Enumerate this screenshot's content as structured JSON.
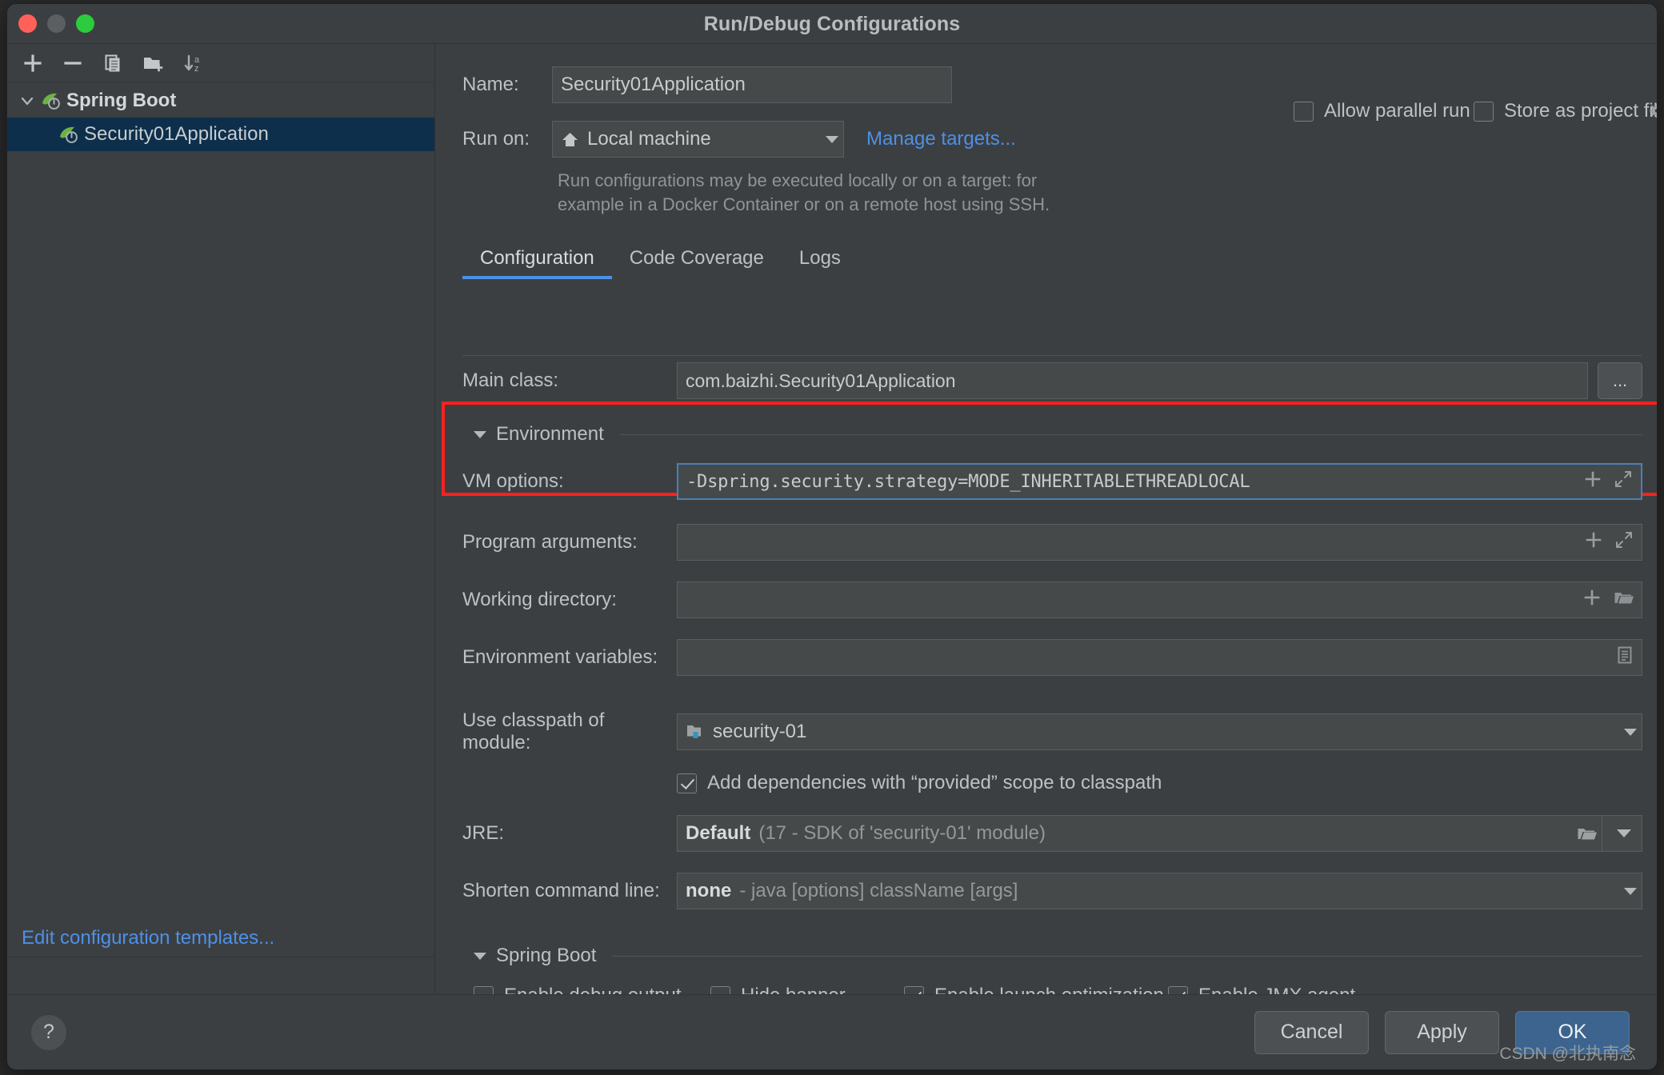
{
  "window": {
    "title": "Run/Debug Configurations",
    "traffic_lights": [
      "close",
      "minimize",
      "zoom"
    ]
  },
  "left_panel": {
    "toolbar": [
      {
        "name": "add-configuration-button",
        "icon": "plus-icon"
      },
      {
        "name": "remove-configuration-button",
        "icon": "minus-icon"
      },
      {
        "name": "copy-configuration-button",
        "icon": "copy-icon"
      },
      {
        "name": "new-folder-button",
        "icon": "folder-add-icon"
      },
      {
        "name": "sort-configurations-button",
        "icon": "sort-az-icon"
      }
    ],
    "tree": [
      {
        "label": "Spring Boot",
        "type": "group",
        "expanded": true,
        "icon": "spring-boot-icon"
      },
      {
        "label": "Security01Application",
        "type": "item",
        "selected": true,
        "icon": "spring-boot-icon"
      }
    ],
    "edit_templates_link": "Edit configuration templates..."
  },
  "form": {
    "name_label": "Name:",
    "name_value": "Security01Application",
    "allow_parallel_run": {
      "label": "Allow parallel run",
      "checked": false
    },
    "store_as_project_file": {
      "label": "Store as project file",
      "checked": false
    },
    "run_on_label": "Run on:",
    "run_on_value": "Local machine",
    "manage_targets_link": "Manage targets...",
    "hint_line_1": "Run configurations may be executed locally or on a target: for",
    "hint_line_2": "example in a Docker Container or on a remote host using SSH."
  },
  "tabs": [
    {
      "label": "Configuration",
      "active": true
    },
    {
      "label": "Code Coverage",
      "active": false
    },
    {
      "label": "Logs",
      "active": false
    }
  ],
  "configuration": {
    "main_class": {
      "label": "Main class:",
      "value": "com.baizhi.Security01Application",
      "browse_button": "..."
    },
    "environment_section": {
      "label": "Environment",
      "expanded": true
    },
    "vm_options": {
      "label": "VM options:",
      "value": "-Dspring.security.strategy=MODE_INHERITABLETHREADLOCAL",
      "focused": true
    },
    "program_arguments": {
      "label": "Program arguments:",
      "value": ""
    },
    "working_directory": {
      "label": "Working directory:",
      "value": ""
    },
    "environment_variables": {
      "label": "Environment variables:",
      "value": ""
    },
    "use_classpath_of_module": {
      "label": "Use classpath of module:",
      "value": "security-01"
    },
    "add_provided_scope": {
      "label": "Add dependencies with “provided” scope to classpath",
      "checked": true
    },
    "jre": {
      "label": "JRE:",
      "value_bold": "Default",
      "value_dim": "(17 - SDK of 'security-01' module)"
    },
    "shorten_command_line": {
      "label": "Shorten command line:",
      "value_bold": "none",
      "value_dim": "- java [options] className [args]"
    },
    "spring_boot_section": {
      "label": "Spring Boot",
      "expanded": true
    },
    "spring_boot_checkboxes": [
      {
        "label": "Enable debug output",
        "checked": false
      },
      {
        "label": "Hide banner",
        "checked": false
      },
      {
        "label": "Enable launch optimization",
        "checked": true
      },
      {
        "label": "Enable JMX agent",
        "checked": true
      }
    ]
  },
  "footer": {
    "help_glyph": "?",
    "cancel": "Cancel",
    "apply": "Apply",
    "ok": "OK"
  },
  "watermark": "CSDN @北执南念",
  "colors": {
    "accent_blue": "#4d90e8",
    "selection_navy": "#0d2f4b",
    "annotation_red": "#ff2020",
    "primary_button": "#3c648f",
    "panel_bg": "#3c3f41",
    "field_bg": "#45494a"
  }
}
